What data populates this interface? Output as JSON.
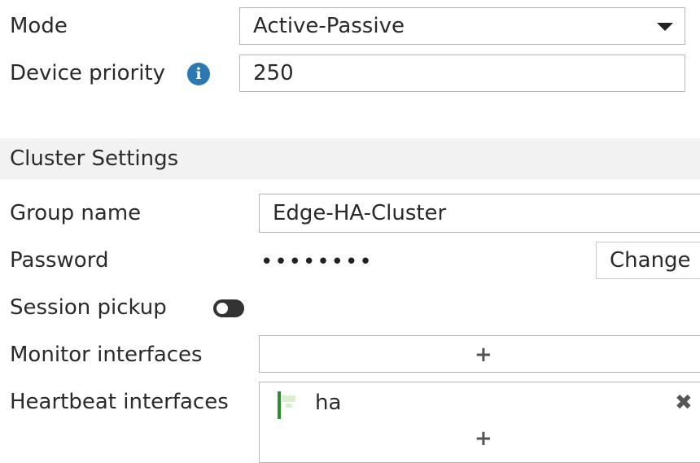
{
  "mode": {
    "label": "Mode",
    "value": "Active-Passive"
  },
  "device_priority": {
    "label": "Device priority",
    "value": "250"
  },
  "cluster_settings": {
    "title": "Cluster Settings",
    "group_name": {
      "label": "Group name",
      "value": "Edge-HA-Cluster"
    },
    "password": {
      "label": "Password",
      "masked": "••••••••",
      "change_label": "Change"
    },
    "session_pickup": {
      "label": "Session pickup",
      "enabled": false
    },
    "monitor_interfaces": {
      "label": "Monitor interfaces",
      "add_glyph": "+"
    },
    "heartbeat_interfaces": {
      "label": "Heartbeat interfaces",
      "items": [
        {
          "name": "ha"
        }
      ],
      "add_glyph": "+",
      "remove_glyph": "✖"
    }
  },
  "colors": {
    "info_icon": "#2b78b3",
    "interface_icon": "#41a541",
    "section_bg": "#f2f2f2"
  }
}
